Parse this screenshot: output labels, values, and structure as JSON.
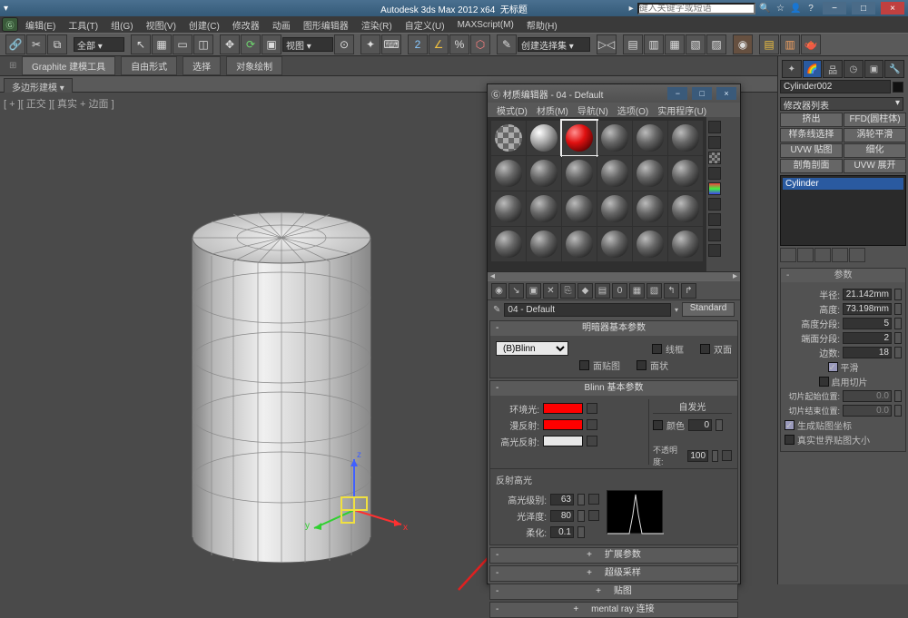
{
  "titlebar": {
    "app": "Autodesk 3ds Max 2012 x64",
    "doc": "无标题",
    "search_placeholder": "键入关键字或短语",
    "window_buttons": {
      "min": "−",
      "max": "□",
      "close": "×"
    }
  },
  "menubar": [
    "编辑(E)",
    "工具(T)",
    "组(G)",
    "视图(V)",
    "创建(C)",
    "修改器",
    "动画",
    "图形编辑器",
    "渲染(R)",
    "自定义(U)",
    "MAXScript(M)",
    "帮助(H)"
  ],
  "toolbar": {
    "scope_selector": "全部",
    "view_selector": "视图",
    "create_sel": "创建选择集"
  },
  "ribbon": {
    "tabs": [
      "Graphite 建模工具",
      "自由形式",
      "选择",
      "对象绘制"
    ],
    "polymodel": "多边形建模"
  },
  "viewport": {
    "label": "[ + ][ 正交 ][ 真实 + 边面 ]"
  },
  "mat_editor": {
    "title": "材质编辑器 - 04 - Default",
    "menus": [
      "模式(D)",
      "材质(M)",
      "导航(N)",
      "选项(O)",
      "实用程序(U)"
    ],
    "name_field": "04 - Default",
    "type_button": "Standard",
    "rollouts": {
      "shader_basic": {
        "title": "明暗器基本参数",
        "shader": "(B)Blinn",
        "wire": "线框",
        "two_sided": "双面",
        "face_map": "面贴图",
        "faceted": "面状"
      },
      "blinn_basic": {
        "title": "Blinn 基本参数",
        "self_illum_title": "自发光",
        "ambient": "环境光:",
        "diffuse": "漫反射:",
        "specular": "高光反射:",
        "color_label": "颜色",
        "color_val": "0",
        "opacity": "不透明度:",
        "opacity_val": "100",
        "colors": {
          "ambient": "#ff0000",
          "diffuse": "#ff0000",
          "specular": "#e8e8e8"
        },
        "spec_section": "反射高光",
        "spec_level": "高光级别:",
        "spec_level_val": "63",
        "gloss": "光泽度:",
        "gloss_val": "80",
        "soften": "柔化:",
        "soften_val": "0.1"
      },
      "extra": [
        "扩展参数",
        "超级采样",
        "贴图",
        "mental ray 连接"
      ]
    }
  },
  "right_panel": {
    "obj_name": "Cylinder002",
    "mod_selector": "修改器列表",
    "mod_buttons": [
      "挤出",
      "FFD(圆柱体)",
      "样条线选择",
      "涡轮平滑",
      "UVW 贴图",
      "细化",
      "剖角剖面",
      "UVW 展开"
    ],
    "stack_top": "Cylinder",
    "params_title": "参数",
    "params": {
      "radius": {
        "label": "半径:",
        "value": "21.142mm"
      },
      "height": {
        "label": "高度:",
        "value": "73.198mm"
      },
      "h_segs": {
        "label": "高度分段:",
        "value": "5"
      },
      "c_segs": {
        "label": "端面分段:",
        "value": "2"
      },
      "sides": {
        "label": "边数:",
        "value": "18"
      },
      "smooth": "平滑",
      "slice_on": "启用切片",
      "slice_from": {
        "label": "切片起始位置:",
        "value": "0.0"
      },
      "slice_to": {
        "label": "切片结束位置:",
        "value": "0.0"
      },
      "gen_uv": "生成贴图坐标",
      "real_world": "真实世界贴图大小"
    }
  }
}
